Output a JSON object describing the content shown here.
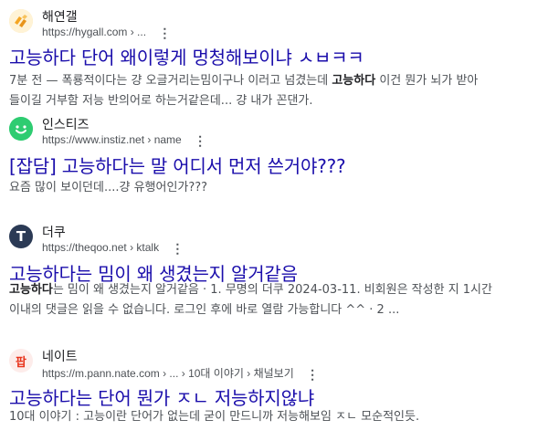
{
  "results": [
    {
      "site_name": "해연갤",
      "url": "https://hygall.com › ...",
      "title": "고능하다 단어 왜이렇게 멍청해보이냐 ㅅㅂㅋㅋ",
      "snippet_line1_pre": "7분 전 — 폭룡적이다는 걍 오글거리는밈이구나 이러고 넘겼는데 ",
      "snippet_line1_bold": "고능하다",
      "snippet_line1_post": " 이건 뭔가 뇌가 받아",
      "snippet_line2": "들이길 거부함 저능 반의어로 하는거같은데... 걍 내가 꼰댄가.",
      "favicon_icon": "hygall-icon",
      "favicon_color": "#f5a623"
    },
    {
      "site_name": "인스티즈",
      "url": "https://www.instiz.net › name",
      "title": "[잡담] 고능하다는 말 어디서 먼저 쓴거야???",
      "snippet_line1": "요즘 많이 보이던데....걍 유행어인가???",
      "favicon_icon": "smiley-icon",
      "favicon_color": "#2ecc71"
    },
    {
      "site_name": "더쿠",
      "url": "https://theqoo.net › ktalk",
      "title": "고능하다는 밈이 왜 생겼는지 알거같음",
      "snippet_line1_bold": "고능하다",
      "snippet_line1_post": "는 밈이 왜 생겼는지 알거같음 · 1. 무명의 더쿠 2024-03-11. 비회원은 작성한 지 1시간",
      "snippet_line2": "이내의 댓글은 읽을 수 없습니다. 로그인 후에 바로 열람 가능합니다 ^^ · 2 ...",
      "favicon_letter": "T",
      "favicon_color": "#2b3a55"
    },
    {
      "site_name": "네이트",
      "url": "https://m.pann.nate.com › ... › 10대 이야기 › 채널보기",
      "title": "고능하다는 단어 뭔가 ㅈㄴ 저능하지않냐",
      "snippet_line1": "10대 이야기 : 고능이란 단어가 없는데 굳이 만드니까 저능해보임 ㅈㄴ 모순적인듯.",
      "favicon_letter": "팝",
      "favicon_color": "#e8341c"
    }
  ]
}
